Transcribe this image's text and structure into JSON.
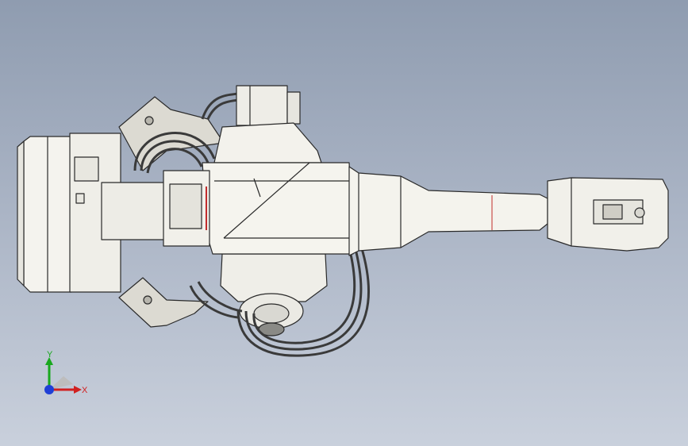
{
  "viewport": {
    "background_top": "#8f9cb0",
    "background_bottom": "#c9d0dc",
    "model_fill": "#f2f1ea",
    "model_stroke": "#2a2a2a",
    "cable_color": "#3a3a3a",
    "accent_red": "#c22c2c"
  },
  "triad": {
    "x_label": "X",
    "y_label": "Y",
    "x_color": "#d12020",
    "y_color": "#19a81e",
    "origin_color": "#1f3fd6"
  }
}
